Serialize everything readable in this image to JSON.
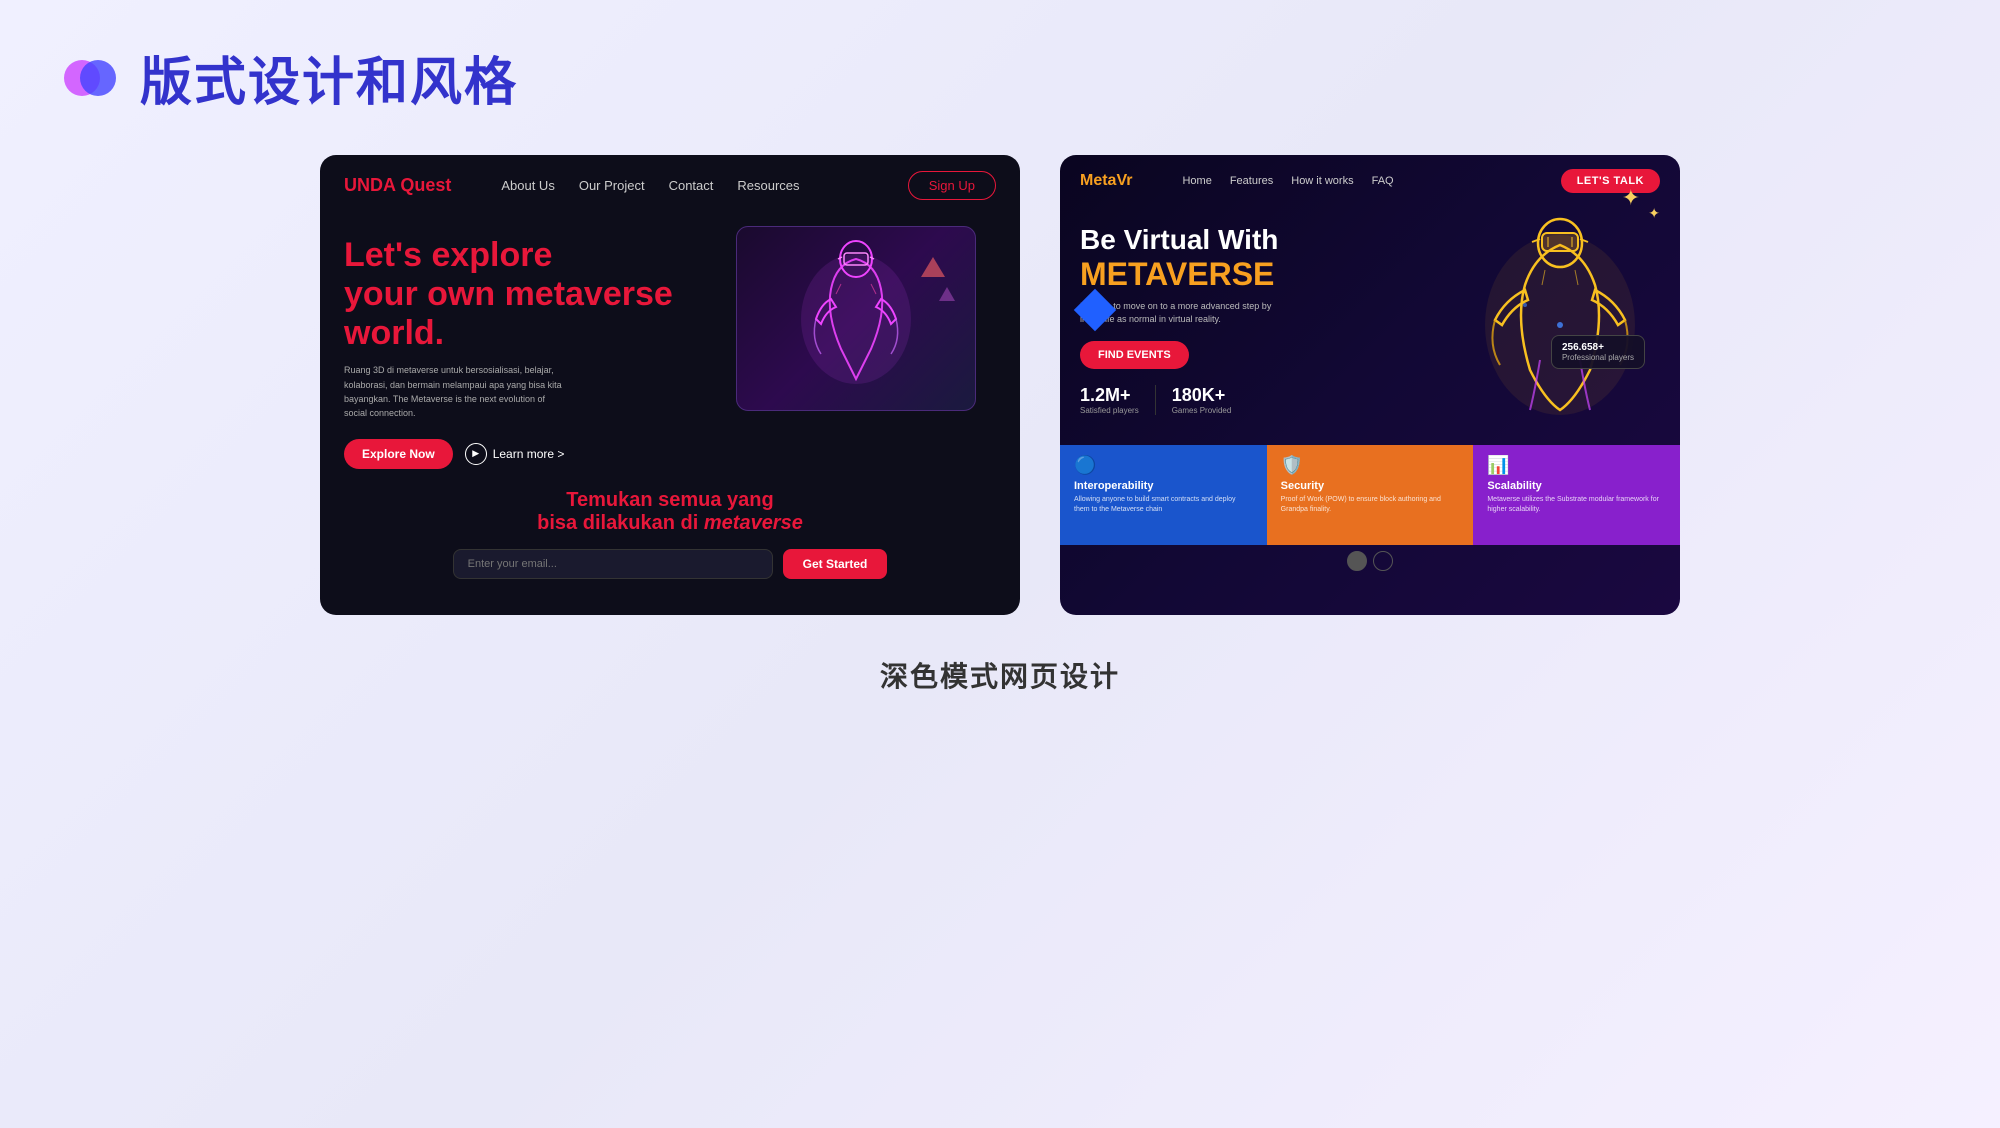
{
  "page": {
    "title": "版式设计和风格",
    "footer_label": "深色模式网页设计"
  },
  "left_preview": {
    "logo_part1": "UNDA",
    "logo_part2": " Quest",
    "nav": {
      "about": "About Us",
      "project": "Our Project",
      "contact": "Contact",
      "resources": "Resources",
      "signup": "Sign Up"
    },
    "hero": {
      "line1": "Let's explore",
      "line2": "your own ",
      "line2_accent": "metaverse",
      "line3": "world.",
      "description": "Ruang 3D di metaverse untuk bersosialisasi, belajar, kolaborasi, dan bermain melampaui apa yang bisa kita bayangkan. The Metaverse is the next evolution of social connection.",
      "btn_explore": "Explore Now",
      "btn_learn": "Learn more >"
    },
    "bottom": {
      "line1": "Temukan semua yang",
      "line2": "bisa dilakukan di ",
      "line2_accent": "metaverse"
    }
  },
  "right_preview": {
    "logo_part1": "MetaV",
    "logo_part2": "r",
    "nav": {
      "home": "Home",
      "features": "Features",
      "how_it_works": "How it works",
      "faq": "FAQ",
      "cta": "LET'S TALK"
    },
    "hero": {
      "line1": "Be Virtual With",
      "line2": "METAVERSE",
      "description": "It's time to move on to a more advanced step by living life as normal in virtual reality.",
      "btn_find": "FIND EVENTS"
    },
    "stats": {
      "stat1_num": "1.2M+",
      "stat1_label": "Satisfied players",
      "stat2_num": "180K+",
      "stat2_label": "Games Provided"
    },
    "badge": {
      "num": "256.658+",
      "label": "Professional players"
    },
    "cards": [
      {
        "title": "Interoperability",
        "icon": "🔵",
        "desc": "Allowing anyone to build smart contracts and deploy them to the Metaverse chain"
      },
      {
        "title": "Security",
        "icon": "🛡",
        "desc": "Proof of Work (POW) to ensure block authoring and Grandpa finality."
      },
      {
        "title": "Scalability",
        "icon": "📊",
        "desc": "Metaverse utilizes the Substrate modular framework for higher scalability."
      }
    ]
  }
}
